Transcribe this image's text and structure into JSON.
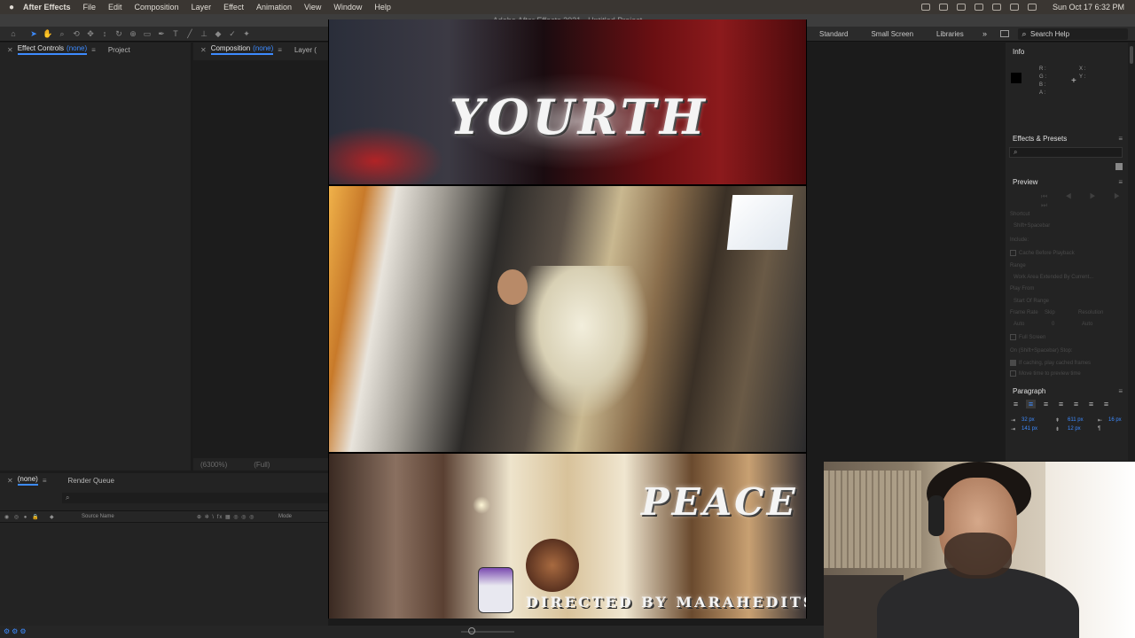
{
  "menubar": {
    "app_name": "After Effects",
    "items": [
      "File",
      "Edit",
      "Composition",
      "Layer",
      "Effect",
      "Animation",
      "View",
      "Window",
      "Help"
    ],
    "clock": "Sun Oct 17  6:32 PM"
  },
  "window_title": "Adobe After Effects 2021 - Untitled Project",
  "toolbar": {
    "workspaces": [
      "Standard",
      "Small Screen",
      "Libraries"
    ],
    "more": "»",
    "search_placeholder": "Search Help"
  },
  "left_panel": {
    "tab_effect_controls": "Effect Controls",
    "tab_effect_controls_value": "(none)",
    "tab_project": "Project",
    "menu": "≡"
  },
  "comp_panel": {
    "tab_composition": "Composition",
    "tab_composition_value": "(none)",
    "tab_layer": "Layer (",
    "zoom": "(6300%)",
    "resolution": "(Full)"
  },
  "timeline": {
    "tab_none": "(none)",
    "tab_render_queue": "Render Queue",
    "search_glyph": "⌕",
    "switch_icons": "◉ ◎ ● 🔒",
    "label_icon": "◆",
    "col_source_name": "Source Name",
    "switch_cols": "⊕ ✲ \\ fx ▦ ◎ ◎ ◎",
    "col_mode": "Mode"
  },
  "info": {
    "title": "Info",
    "r": "R :",
    "g": "G :",
    "b": "B :",
    "a": "A :",
    "x": "X :",
    "y": "Y :"
  },
  "effects_presets": {
    "title": "Effects & Presets",
    "search_glyph": "⌕"
  },
  "preview": {
    "title": "Preview",
    "controls": "⏮ ◀ ▶ ▶ ⏭",
    "shortcut_label": "Shortcut",
    "shortcut_value": "Shift+Spacebar",
    "include_label": "Include:",
    "cache_before_playback": "Cache Before Playback",
    "range_label": "Range",
    "range_value": "Work Area Extended By Current...",
    "play_from_label": "Play From",
    "play_from_value": "Start Of Range",
    "frame_rate_label": "Frame Rate",
    "skip_label": "Skip",
    "resolution_label": "Resolution",
    "frame_rate_value": "Auto",
    "skip_value": "0",
    "resolution_value": "Auto",
    "full_screen": "Full Screen",
    "on_stop_label": "On (Shift+Spacebar) Stop:",
    "if_caching": "If caching, play cached frames",
    "move_time": "Move time to preview time"
  },
  "paragraph": {
    "title": "Paragraph",
    "indent_left": "32 px",
    "indent_first": "141 px",
    "space_before": "611 px",
    "space_after": "12 px",
    "indent_right": "16 px"
  },
  "composition_overlay": {
    "title_text": "YOURTH",
    "peace_text": "PEACE",
    "director_text": "DIRECTED BY MARAHEDITS"
  },
  "colors": {
    "accent": "#3d8bff",
    "panel_bg": "#232323",
    "app_bg": "#1b1b1b"
  }
}
